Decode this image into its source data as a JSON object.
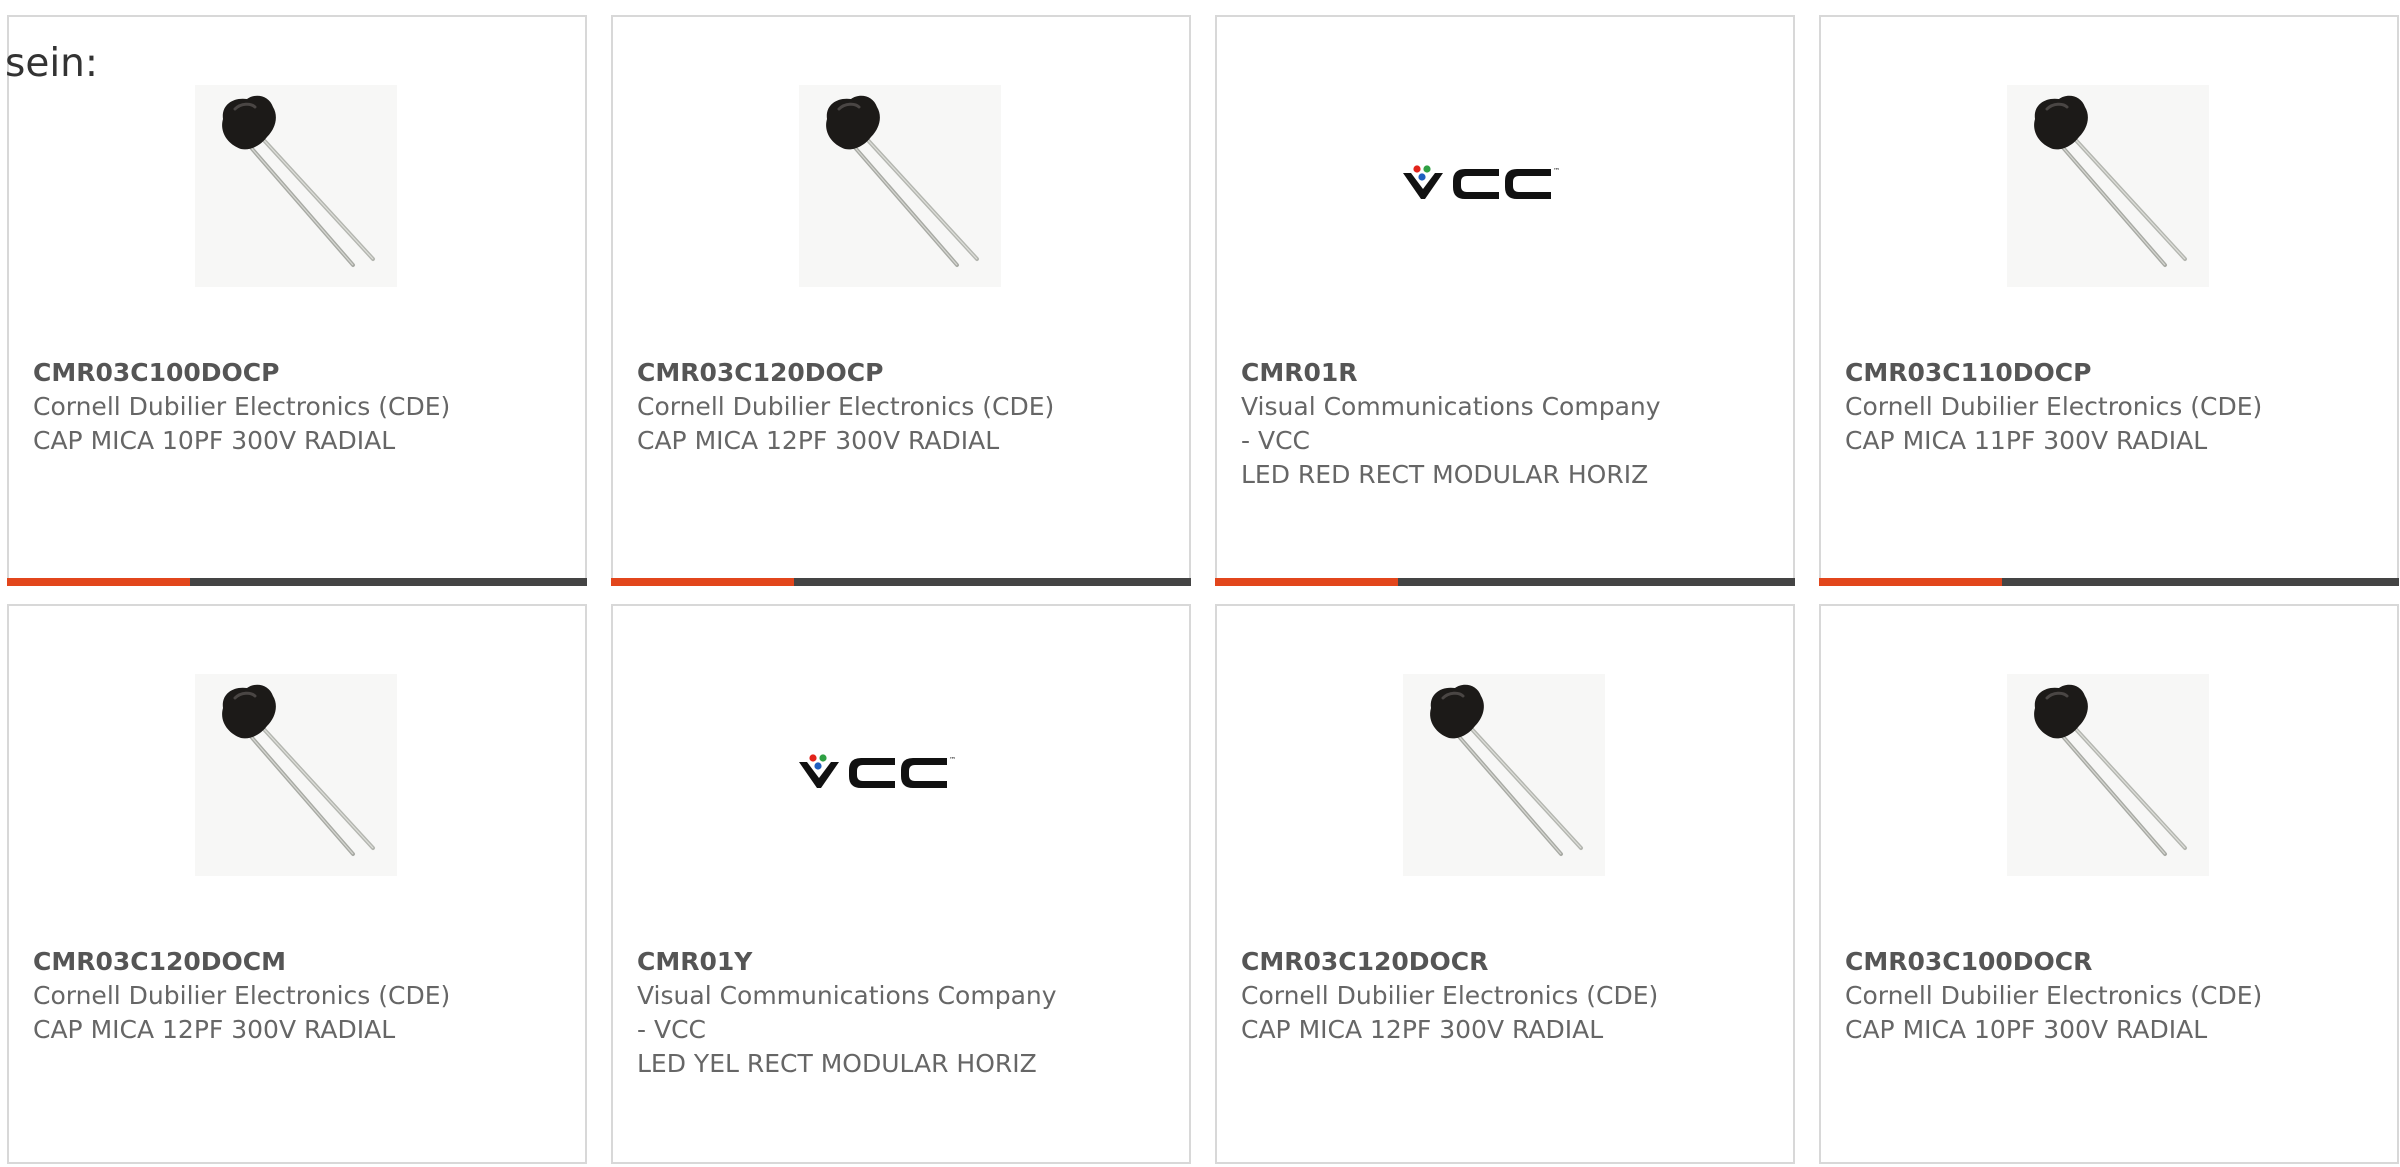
{
  "intro_text": "sein:",
  "colors": {
    "accent": "#e2461c",
    "bar": "#444444",
    "border": "#d8d8d8",
    "text": "#666666",
    "vcc_red": "#e2231a",
    "vcc_green": "#2ea043",
    "vcc_blue": "#1f5fbf"
  },
  "products": [
    {
      "part_number": "CMR03C100DOCP",
      "manufacturer": "Cornell Dubilier Electronics (CDE)",
      "manufacturer_line2": "",
      "description": "CAP MICA 10PF 300V RADIAL",
      "image": "mica-capacitor-icon"
    },
    {
      "part_number": "CMR03C120DOCP",
      "manufacturer": "Cornell Dubilier Electronics (CDE)",
      "manufacturer_line2": "",
      "description": "CAP MICA 12PF 300V RADIAL",
      "image": "mica-capacitor-icon"
    },
    {
      "part_number": "CMR01R",
      "manufacturer": "Visual Communications Company",
      "manufacturer_line2": "- VCC",
      "description": "LED RED RECT MODULAR HORIZ",
      "image": "vcc-logo",
      "logo_text": "VCC",
      "logo_tm": "™"
    },
    {
      "part_number": "CMR03C110DOCP",
      "manufacturer": "Cornell Dubilier Electronics (CDE)",
      "manufacturer_line2": "",
      "description": "CAP MICA 11PF 300V RADIAL",
      "image": "mica-capacitor-icon"
    },
    {
      "part_number": "CMR03C120DOCM",
      "manufacturer": "Cornell Dubilier Electronics (CDE)",
      "manufacturer_line2": "",
      "description": "CAP MICA 12PF 300V RADIAL",
      "image": "mica-capacitor-icon"
    },
    {
      "part_number": "CMR01Y",
      "manufacturer": "Visual Communications Company",
      "manufacturer_line2": "- VCC",
      "description": "LED YEL RECT MODULAR HORIZ",
      "image": "vcc-logo",
      "logo_text": "VCC",
      "logo_tm": "™"
    },
    {
      "part_number": "CMR03C120DOCR",
      "manufacturer": "Cornell Dubilier Electronics (CDE)",
      "manufacturer_line2": "",
      "description": "CAP MICA 12PF 300V RADIAL",
      "image": "mica-capacitor-icon"
    },
    {
      "part_number": "CMR03C100DOCR",
      "manufacturer": "Cornell Dubilier Electronics (CDE)",
      "manufacturer_line2": "",
      "description": "CAP MICA 10PF 300V RADIAL",
      "image": "mica-capacitor-icon"
    }
  ]
}
